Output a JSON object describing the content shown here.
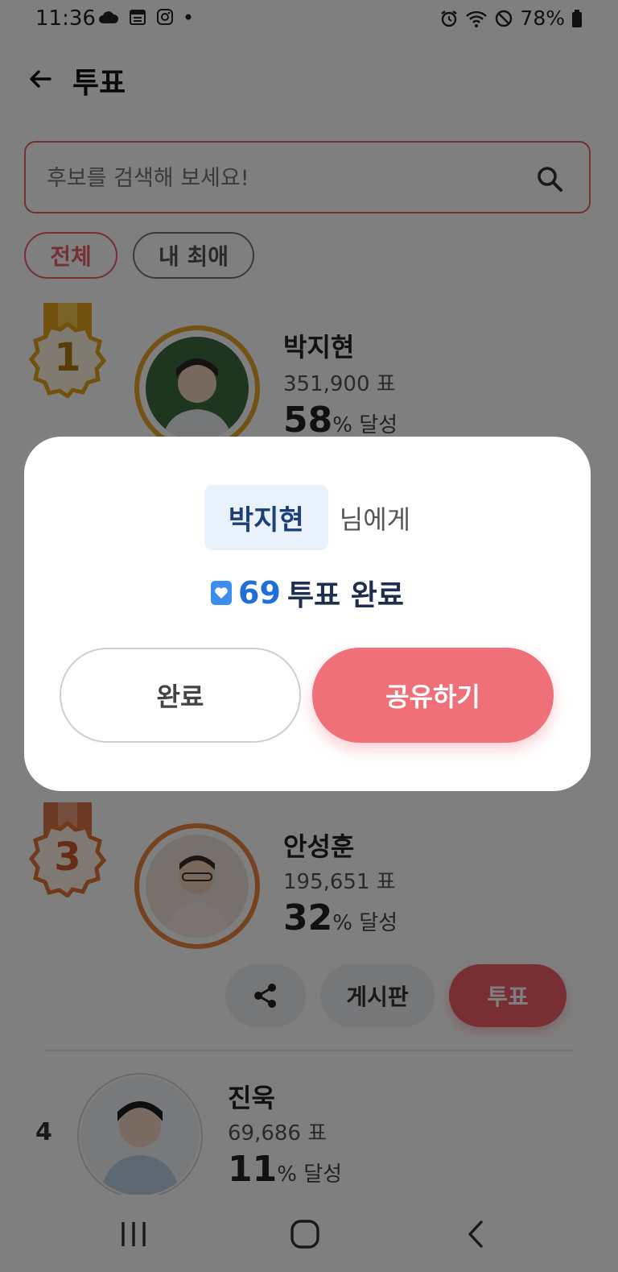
{
  "status_bar": {
    "time": "11:36",
    "battery": "78%",
    "icons": [
      "cloud-icon",
      "calendar-icon",
      "instagram-icon",
      "dot-icon",
      "alarm-icon",
      "wifi-icon",
      "do-not-disturb-icon",
      "battery-icon"
    ]
  },
  "header": {
    "title": "투표",
    "back_icon": "back-arrow-icon"
  },
  "search": {
    "placeholder": "후보를 검색해 보세요!",
    "value": ""
  },
  "filters": {
    "all": "전체",
    "favorite": "내 최애"
  },
  "candidates": [
    {
      "rank": "1",
      "name": "박지현",
      "votes": "351,900 표",
      "percent": "58",
      "percent_suffix": "% 달성",
      "medal_color": "#e2a21a"
    },
    {
      "rank": "3",
      "name": "안성훈",
      "votes": "195,651 표",
      "percent": "32",
      "percent_suffix": "% 달성",
      "medal_color": "#e2743a",
      "actions": {
        "board": "게시판",
        "vote": "투표"
      }
    },
    {
      "rank": "4",
      "name": "진욱",
      "votes": "69,686 표",
      "percent": "11",
      "percent_suffix": "% 달성"
    }
  ],
  "dialog": {
    "recipient_name": "박지현",
    "recipient_suffix": "님에게",
    "vote_count": "69",
    "vote_done_text": "투표 완료",
    "done_button": "완료",
    "share_button": "공유하기"
  },
  "colors": {
    "accent": "#ef5f69",
    "vote_blue": "#1f6fd8"
  }
}
